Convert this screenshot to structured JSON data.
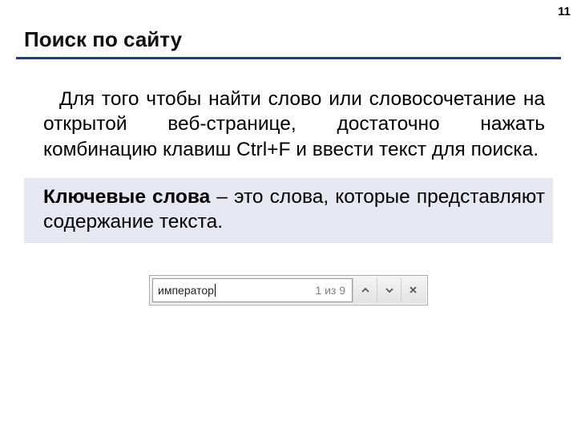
{
  "page_number": "11",
  "title": "Поиск по сайту",
  "paragraph": "Для того чтобы найти слово или словосочетание на открытой веб-странице, достаточно нажать комбинацию клавиш Ctrl+F и ввести текст для поиска.",
  "definition": {
    "term": "Ключевые слова",
    "dash": " – ",
    "rest": "это слова, которые представляют содержание текста."
  },
  "find_bar": {
    "input_value": "император",
    "count_text": "1 из 9"
  },
  "colors": {
    "accent": "#1f3b87",
    "definition_bg": "#e7e7f1"
  }
}
